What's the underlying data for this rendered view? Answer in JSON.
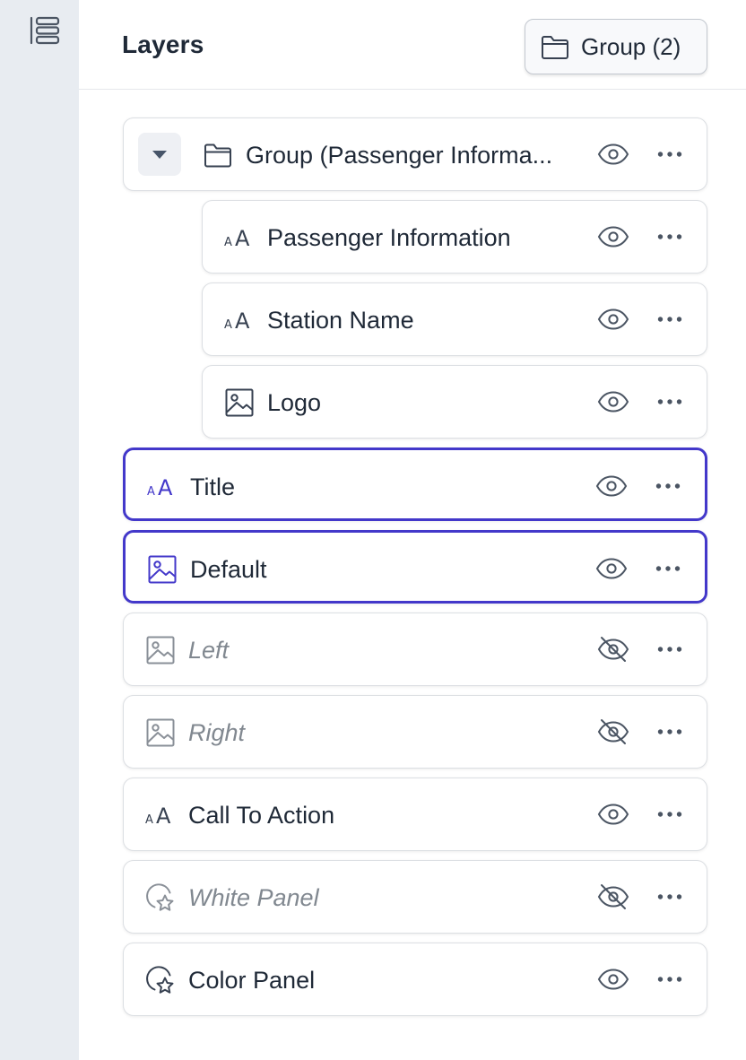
{
  "panel": {
    "title": "Layers",
    "group_button_label": "Group (2)"
  },
  "colors": {
    "accent": "#4338ca",
    "rail_background": "#e8ecf1",
    "row_border": "#dcdfe3",
    "muted_text": "#818890"
  },
  "layers": [
    {
      "label": "Group (Passenger Informa...",
      "icon": "folder-icon",
      "visible": true,
      "selected": false,
      "expanded": true,
      "depth": 0
    },
    {
      "label": "Passenger Information",
      "icon": "text-icon",
      "visible": true,
      "selected": false,
      "depth": 1
    },
    {
      "label": "Station Name",
      "icon": "text-icon",
      "visible": true,
      "selected": false,
      "depth": 1
    },
    {
      "label": "Logo",
      "icon": "image-icon",
      "visible": true,
      "selected": false,
      "depth": 1
    },
    {
      "label": "Title",
      "icon": "text-icon",
      "visible": true,
      "selected": true,
      "depth": 0
    },
    {
      "label": "Default",
      "icon": "image-icon",
      "visible": true,
      "selected": true,
      "depth": 0
    },
    {
      "label": "Left",
      "icon": "image-icon",
      "visible": false,
      "selected": false,
      "depth": 0
    },
    {
      "label": "Right",
      "icon": "image-icon",
      "visible": false,
      "selected": false,
      "depth": 0
    },
    {
      "label": "Call To Action",
      "icon": "text-icon",
      "visible": true,
      "selected": false,
      "depth": 0
    },
    {
      "label": "White Panel",
      "icon": "shape-icon",
      "visible": false,
      "selected": false,
      "depth": 0
    },
    {
      "label": "Color Panel",
      "icon": "shape-icon",
      "visible": true,
      "selected": false,
      "depth": 0
    }
  ]
}
